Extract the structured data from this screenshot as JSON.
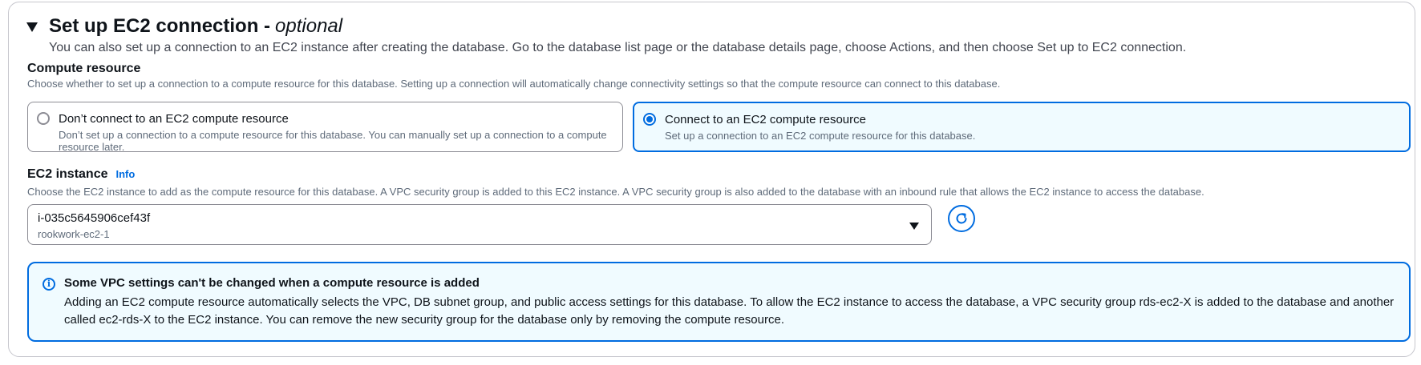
{
  "section": {
    "title": "Set up EC2 connection -",
    "title_optional": "optional",
    "description": "You can also set up a connection to an EC2 instance after creating the database. Go to the database list page or the database details page, choose Actions, and then choose Set up to EC2 connection."
  },
  "compute_resource": {
    "label": "Compute resource",
    "description": "Choose whether to set up a connection to a compute resource for this database. Setting up a connection will automatically change connectivity settings so that the compute resource can connect to this database.",
    "options": [
      {
        "title": "Don’t connect to an EC2 compute resource",
        "description": "Don’t set up a connection to a compute resource for this database. You can manually set up a connection to a compute resource later.",
        "selected": false
      },
      {
        "title": "Connect to an EC2 compute resource",
        "description": "Set up a connection to an EC2 compute resource for this database.",
        "selected": true
      }
    ]
  },
  "ec2_instance": {
    "label": "EC2 instance",
    "info_link": "Info",
    "description": "Choose the EC2 instance to add as the compute resource for this database. A VPC security group is added to this EC2 instance. A VPC security group is also added to the database with an inbound rule that allows the EC2 instance to access the database.",
    "selected_value": "i-035c5645906cef43f",
    "selected_name": "rookwork-ec2-1"
  },
  "alert": {
    "title": "Some VPC settings can't be changed when a compute resource is added",
    "body": "Adding an EC2 compute resource automatically selects the VPC, DB subnet group, and public access settings for this database. To allow the EC2 instance to access the database, a VPC security group rds-ec2-X is added to the database and another called ec2-rds-X to the EC2 instance. You can remove the new security group for the database only by removing the compute resource.",
    "icon_glyph": "i"
  },
  "colors": {
    "accent": "#006ce0",
    "selected_bg": "#f0fbff",
    "text": "#0f141a",
    "secondary_text": "#5f6b7a"
  }
}
